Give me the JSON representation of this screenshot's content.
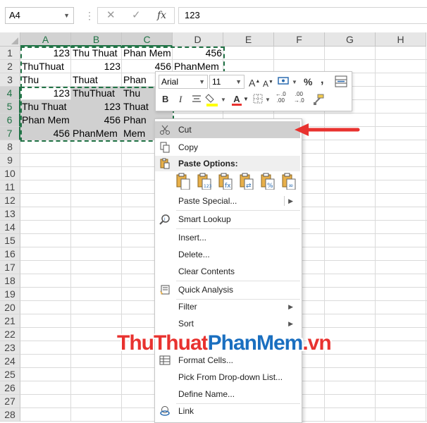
{
  "name_box": "A4",
  "formula_bar": {
    "value": "123",
    "fx": "fx",
    "cancel": "✕",
    "enter": "✓"
  },
  "columns": [
    "A",
    "B",
    "C",
    "D",
    "E",
    "F",
    "G",
    "H"
  ],
  "rows": [
    "1",
    "2",
    "3",
    "4",
    "5",
    "6",
    "7",
    "8",
    "9",
    "10",
    "11",
    "12",
    "13",
    "14",
    "15",
    "16",
    "17",
    "18",
    "19",
    "20",
    "21",
    "22",
    "23",
    "24",
    "25",
    "26",
    "27",
    "28"
  ],
  "cells": {
    "A1": "123",
    "B1": "Thu Thuat",
    "C1": "Phan Mem",
    "D1": "456",
    "A2": "ThuThuat",
    "B2": "123",
    "C2": "456",
    "D2": "PhanMem",
    "A3": "Thu",
    "B3": "Thuat",
    "C3": "Phan",
    "A4": "123",
    "B4": "ThuThuat",
    "C4": "Thu",
    "A5": "Thu Thuat",
    "B5": "123",
    "C5": "Thuat",
    "A6": "Phan Mem",
    "B6": "456",
    "C6": "Phan",
    "A7": "456",
    "B7": "PhanMem",
    "C7": "Mem"
  },
  "mini_toolbar": {
    "font": "Arial",
    "size": "11",
    "grow": "A",
    "shrink": "A",
    "percent": "%",
    "comma": ",",
    "bold": "B",
    "italic": "I",
    "font_color": "A",
    "inc_decimal": "←.0\n.00",
    "dec_decimal": ".00\n→.0"
  },
  "context_menu": {
    "cut": "Cut",
    "copy": "Copy",
    "paste_options": "Paste Options:",
    "paste_special": "Paste Special...",
    "smart_lookup": "Smart Lookup",
    "insert": "Insert...",
    "delete": "Delete...",
    "clear_contents": "Clear Contents",
    "quick_analysis": "Quick Analysis",
    "filter": "Filter",
    "sort": "Sort",
    "format_cells": "Format Cells...",
    "pick_list": "Pick From Drop-down List...",
    "define_name": "Define Name...",
    "link": "Link"
  },
  "paste_icons": [
    "paste-icon",
    "paste-values-icon",
    "paste-formulas-icon",
    "paste-transpose-icon",
    "paste-formatting-icon",
    "paste-link-icon"
  ],
  "watermark": {
    "part1": "ThuThuat",
    "part2": "PhanMem",
    "part3": ".vn"
  },
  "colors": {
    "accent": "#217346",
    "arrow": "#e8322f",
    "wm_red": "#e8322f",
    "wm_blue": "#1a6fc0"
  }
}
